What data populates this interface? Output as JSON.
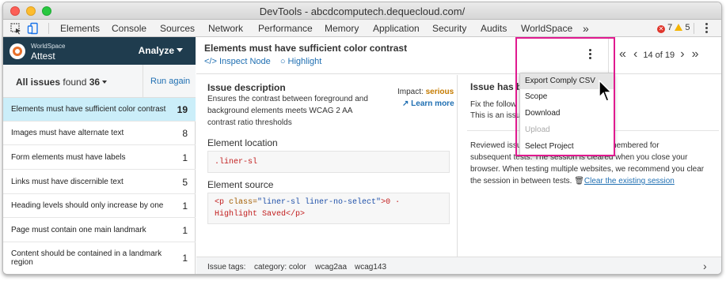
{
  "window": {
    "title": "DevTools - abcdcomputech.dequecloud.com/"
  },
  "devtools_tabs": [
    "Elements",
    "Console",
    "Sources",
    "Network",
    "Performance",
    "Memory",
    "Application",
    "Security",
    "Audits",
    "WorldSpace"
  ],
  "more_tabs": "»",
  "errors": {
    "error_count": "7",
    "warning_count": "5"
  },
  "brand": {
    "top": "WorldSpace",
    "name": "Attest",
    "analyze": "Analyze"
  },
  "filter": {
    "prefix": "All issues",
    "found_word": "found",
    "count": "36",
    "run_again": "Run again"
  },
  "issues": [
    {
      "label": "Elements must have sufficient color contrast",
      "count": "19"
    },
    {
      "label": "Images must have alternate text",
      "count": "8"
    },
    {
      "label": "Form elements must have labels",
      "count": "1"
    },
    {
      "label": "Links must have discernible text",
      "count": "5"
    },
    {
      "label": "Heading levels should only increase by one",
      "count": "1"
    },
    {
      "label": "Page must contain one main landmark",
      "count": "1"
    },
    {
      "label": "Content should be contained in a landmark region",
      "count": "1"
    }
  ],
  "issue_detail": {
    "title": "Elements must have sufficient color contrast",
    "inspect": "</> Inspect Node",
    "highlight": "Highlight",
    "pager": "14 of 19",
    "description_title": "Issue description",
    "description": "Ensures the contrast between foreground and background elements meets WCAG 2 AA contrast ratio thresholds",
    "impact_label": "Impact:",
    "impact_value": "serious",
    "learn_more": "Learn more",
    "location_title": "Element location",
    "location_code": ".liner-sl",
    "source_title": "Element source",
    "source_line1_tag": "<p ",
    "source_line1_attr": "class=",
    "source_line1_val": "\"liner-sl liner-no-select\"",
    "source_line1_end": ">0 ·",
    "source_line2": "Highlight Saved</p>"
  },
  "help": {
    "title": "Issue has b",
    "fix_line": "Fix the follow",
    "issue_line": "This is an issu",
    "session_prefix": "Reviewed issu",
    "session_suffix": "d will be remembered for",
    "session_line2": "subsequent tests. The session is cleared when you close your",
    "session_line3": "browser. When testing multiple websites, we recommend you clear",
    "session_line4": "the session in between tests.",
    "clear_link": "Clear the existing session"
  },
  "tags": {
    "label": "Issue tags:",
    "items": [
      "category: color",
      "wcag2aa",
      "wcag143"
    ]
  },
  "menu": {
    "items": [
      {
        "label": "Export Comply CSV",
        "state": "hover"
      },
      {
        "label": "Scope",
        "state": "normal"
      },
      {
        "label": "Download",
        "state": "normal"
      },
      {
        "label": "Upload",
        "state": "disabled"
      },
      {
        "label": "Select Project",
        "state": "normal"
      }
    ]
  },
  "colors": {
    "brand_bar": "#1f3c4e",
    "selected_row": "#cbeef9",
    "link": "#1f6fb2",
    "highlight": "#e01a8f",
    "impact": "#c57b00"
  }
}
